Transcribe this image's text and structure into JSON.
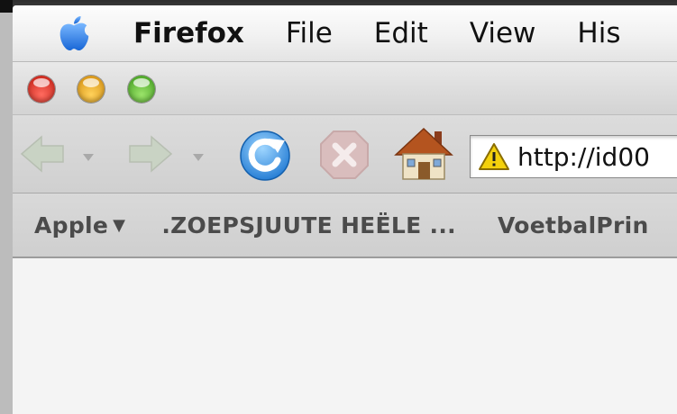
{
  "menubar": {
    "app_name": "Firefox",
    "items": [
      "File",
      "Edit",
      "View",
      "His"
    ]
  },
  "window": {
    "controls": [
      "close",
      "minimize",
      "zoom"
    ]
  },
  "navbar": {
    "icons": [
      "back-arrow-icon",
      "forward-arrow-icon",
      "reload-icon",
      "stop-icon",
      "home-icon",
      "warning-icon"
    ],
    "url": "http://id00"
  },
  "bookmarks": {
    "items": [
      "Apple",
      ".ZOEPSJUUTE HEËLE ...",
      "VoetbalPrin"
    ],
    "caret": "▼"
  },
  "colors": {
    "reload_blue": "#2f8fe0",
    "warning_yellow": "#f4d10c",
    "close_red": "#e0392c",
    "minimize_yellow": "#f2b22a",
    "zoom_green": "#5cbf2f"
  }
}
